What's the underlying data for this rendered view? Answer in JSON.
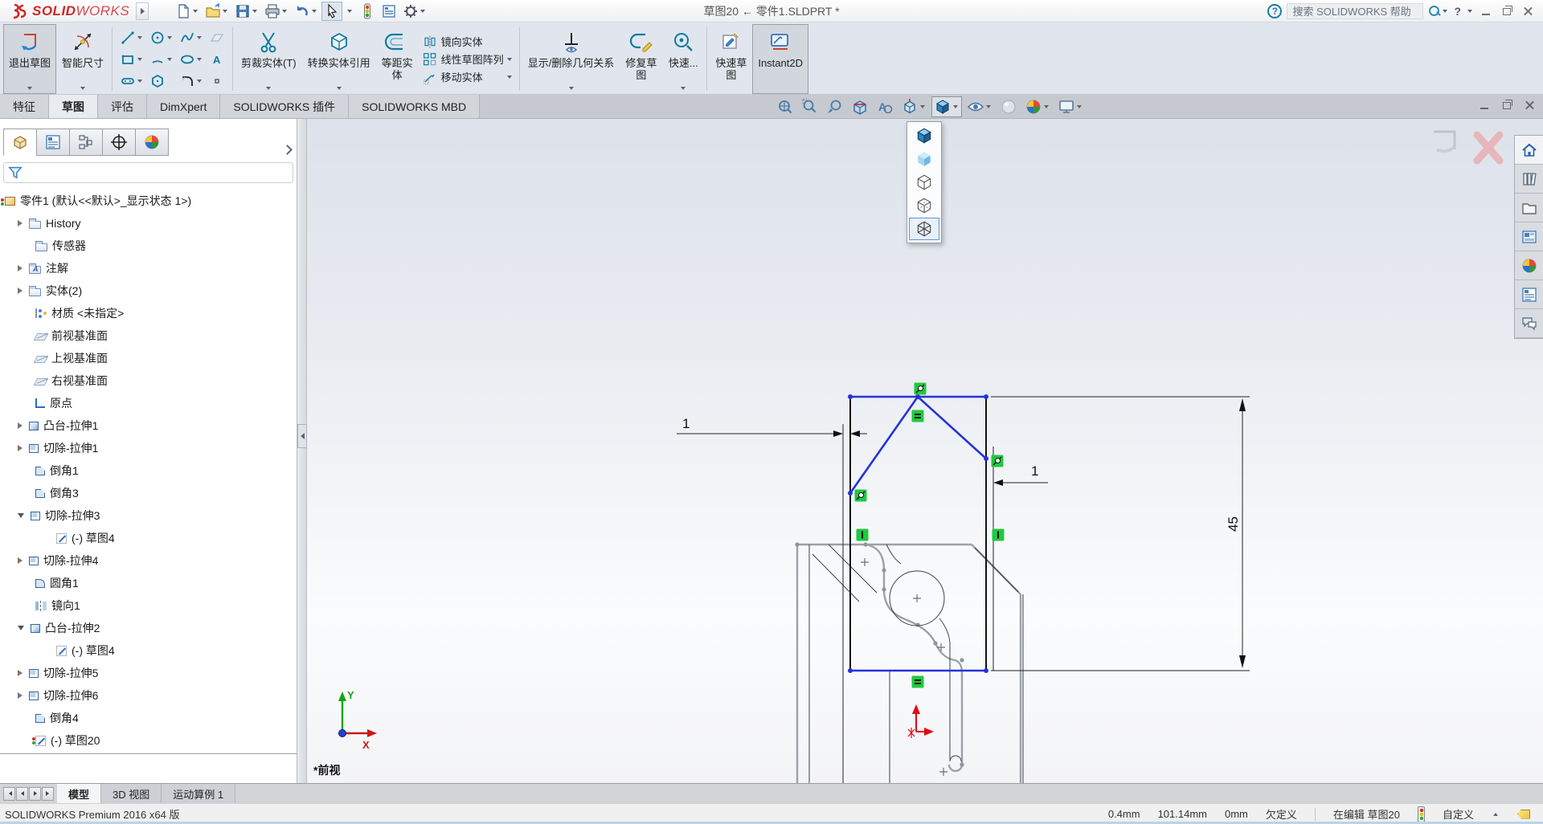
{
  "titlebar": {
    "logo_text_bold": "SOLID",
    "logo_text_light": "WORKS",
    "title": "草图20 ← 零件1.SLDPRT *",
    "help_mark": "?",
    "search_placeholder": "搜索 SOLIDWORKS 帮助",
    "quick_access_icons": [
      "new-document",
      "open",
      "save",
      "print",
      "undo",
      "select-cursor",
      "options-traffic-light",
      "properties-list",
      "settings-gear"
    ]
  },
  "ribbon": {
    "exit_sketch": "退出草图",
    "smart_dimension": "智能尺寸",
    "trim_entities": "剪裁实体(T)",
    "convert_entities": "转换实体引用",
    "offset_entities": "等距实\n体",
    "mirror_entities": "镜向实体",
    "linear_pattern": "线性草图阵列",
    "move_entities": "移动实体",
    "display_relations": "显示/删除几何关系",
    "repair_sketch": "修复草\n图",
    "quick_snaps": "快速...",
    "rapid_sketch": "快速草\n图",
    "instant2d": "Instant2D",
    "sketch_tool_icons": [
      "line",
      "circle",
      "spline",
      "plane",
      "rectangle",
      "arc",
      "ellipse",
      "text",
      "slot",
      "polygon",
      "fillet",
      "point"
    ]
  },
  "command_tabs": {
    "items": [
      "特征",
      "草图",
      "评估",
      "DimXpert",
      "SOLIDWORKS 插件",
      "SOLIDWORKS MBD"
    ],
    "active": "草图"
  },
  "headsup_icons": [
    "zoom-to-fit",
    "zoom-to-area",
    "previous-view",
    "section-view",
    "hide-annotations",
    "view-orientation",
    "display-style",
    "hide-show-items",
    "edit-appearance",
    "apply-scene",
    "view-settings"
  ],
  "display_style_menu": {
    "items": [
      "shaded-with-edges",
      "shaded",
      "hidden-lines-removed",
      "hidden-lines-visible",
      "wireframe"
    ],
    "selected": "wireframe"
  },
  "left_panel": {
    "tab_icons": [
      "featuremanager",
      "propertymanager",
      "configurationmanager",
      "dimxpertmanager",
      "displaymanager"
    ],
    "root_label": "零件1 (默认<<默认>_显示状态 1>)",
    "items": [
      {
        "label": "History",
        "expand": "collapsed",
        "icon": "folder-history"
      },
      {
        "label": "传感器",
        "expand": "none",
        "icon": "folder-sensors"
      },
      {
        "label": "注解",
        "expand": "collapsed",
        "icon": "folder-annotations"
      },
      {
        "label": "实体(2)",
        "expand": "collapsed",
        "icon": "folder-bodies"
      },
      {
        "label": "材质 <未指定>",
        "expand": "none",
        "icon": "material"
      },
      {
        "label": "前视基准面",
        "expand": "none",
        "icon": "plane"
      },
      {
        "label": "上视基准面",
        "expand": "none",
        "icon": "plane"
      },
      {
        "label": "右视基准面",
        "expand": "none",
        "icon": "plane"
      },
      {
        "label": "原点",
        "expand": "none",
        "icon": "origin"
      },
      {
        "label": "凸台-拉伸1",
        "expand": "collapsed",
        "icon": "boss-extrude"
      },
      {
        "label": "切除-拉伸1",
        "expand": "collapsed",
        "icon": "cut-extrude"
      },
      {
        "label": "倒角1",
        "expand": "none",
        "icon": "chamfer"
      },
      {
        "label": "倒角3",
        "expand": "none",
        "icon": "chamfer"
      },
      {
        "label": "切除-拉伸3",
        "expand": "expanded",
        "icon": "cut-extrude"
      },
      {
        "label": "(-) 草图4",
        "expand": "child",
        "icon": "sketch"
      },
      {
        "label": "切除-拉伸4",
        "expand": "collapsed",
        "icon": "cut-extrude"
      },
      {
        "label": "圆角1",
        "expand": "none",
        "icon": "fillet"
      },
      {
        "label": "镜向1",
        "expand": "none",
        "icon": "mirror"
      },
      {
        "label": "凸台-拉伸2",
        "expand": "expanded",
        "icon": "boss-extrude"
      },
      {
        "label": "(-) 草图4",
        "expand": "child",
        "icon": "sketch"
      },
      {
        "label": "切除-拉伸5",
        "expand": "collapsed",
        "icon": "cut-extrude"
      },
      {
        "label": "切除-拉伸6",
        "expand": "collapsed",
        "icon": "cut-extrude"
      },
      {
        "label": "倒角4",
        "expand": "none",
        "icon": "chamfer"
      },
      {
        "label": "(-) 草图20",
        "expand": "none",
        "icon": "sketch-editing"
      }
    ]
  },
  "viewport": {
    "view_label": "*前视",
    "dimensions": {
      "left": "1",
      "right": "1",
      "height": "45"
    },
    "axes": {
      "x": "X",
      "y": "Y"
    },
    "relation_icons": [
      "tangent",
      "equal",
      "tangent",
      "tangent",
      "vertical",
      "vertical",
      "equal"
    ],
    "colors": {
      "sketch_blue": "#2433d9",
      "relation_green": "#1fc93e",
      "origin_red": "#e30613",
      "axis_green": "#17a317",
      "model_gray": "#9ba1a8"
    }
  },
  "taskpane_icons": [
    "home",
    "design-library",
    "file-explorer",
    "view-palette",
    "appearances",
    "custom-properties",
    "forum"
  ],
  "bottom_tabs": {
    "items": [
      "模型",
      "3D 视图",
      "运动算例 1"
    ],
    "active": "模型"
  },
  "statusbar": {
    "product": "SOLIDWORKS Premium 2016 x64 版",
    "grid_snap": "0.4mm",
    "position": "101.14mm",
    "zero": "0mm",
    "define_state": "欠定义",
    "editing": "在编辑 草图20",
    "custom": "自定义"
  }
}
